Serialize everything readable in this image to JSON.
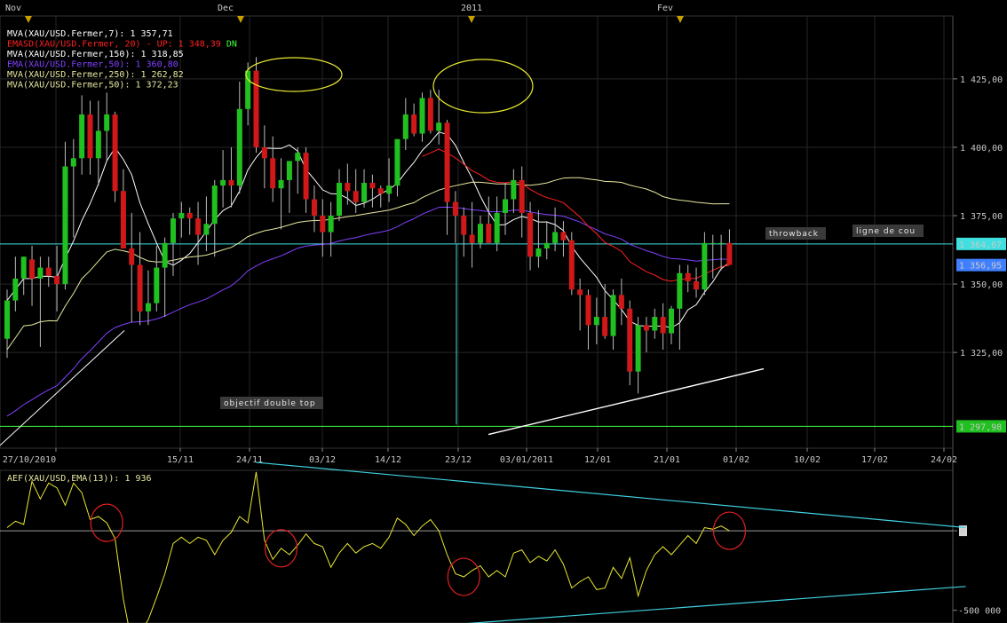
{
  "chart_data": [
    {
      "type": "candlestick",
      "months": [
        "Nov",
        "Dec",
        "2011",
        "Fev"
      ],
      "legend": [
        {
          "text": "MVA(XAU/USD.Fermer,7): 1 357,71",
          "color": "#ffffff",
          "extra": "",
          "extra_color": ""
        },
        {
          "text": "EMASD(XAU/USD.Fermer, 20) - UP: 1 348,39",
          "color": "#ff2020",
          "extra": "DN",
          "extra_color": "#40ff40"
        },
        {
          "text": "MVA(XAU/USD.Fermer,150): 1 318,85",
          "color": "#ffffff",
          "extra": "",
          "extra_color": ""
        },
        {
          "text": "EMA(XAU/USD.Fermer,50): 1 360,80",
          "color": "#8040ff",
          "extra": "",
          "extra_color": ""
        },
        {
          "text": "MVA(XAU/USD.Fermer,250): 1 262,82",
          "color": "#e8e8a0",
          "extra": "",
          "extra_color": ""
        },
        {
          "text": "MVA(XAU/USD.Fermer,50): 1 372,23",
          "color": "#e8e8a0",
          "extra": "",
          "extra_color": ""
        }
      ],
      "y_ticks": [
        "1 425,00",
        "1 400,00",
        "1 375,00",
        "1 350,00",
        "1 325,00"
      ],
      "y_tick_values": [
        1425,
        1400,
        1375,
        1350,
        1325
      ],
      "ylim": [
        1290,
        1448
      ],
      "x_ticks": [
        "27/10/2010",
        "15/11",
        "24/11",
        "03/12",
        "14/12",
        "23/12",
        "03/01/2011",
        "12/01",
        "21/01",
        "01/02",
        "10/02",
        "17/02",
        "24/02"
      ],
      "price_labels": [
        {
          "text": "1 364,67",
          "value": 1364.67,
          "bg": "#40e0e0"
        },
        {
          "text": "1 356,95",
          "value": 1356.95,
          "bg": "#4080ff"
        },
        {
          "text": "1 297,98",
          "value": 1297.98,
          "bg": "#20c020"
        }
      ],
      "horizontal_lines": [
        {
          "value": 1364.67,
          "color": "#40e0e0"
        },
        {
          "value": 1297.98,
          "color": "#40ff40"
        }
      ],
      "annotations": [
        "objectif double top",
        "throwback",
        "ligne de cou"
      ],
      "candles": [
        {
          "o": 1330,
          "h": 1348,
          "l": 1323,
          "c": 1344
        },
        {
          "o": 1344,
          "h": 1360,
          "l": 1340,
          "c": 1352
        },
        {
          "o": 1352,
          "h": 1360,
          "l": 1346,
          "c": 1360
        },
        {
          "o": 1359,
          "h": 1364,
          "l": 1342,
          "c": 1352
        },
        {
          "o": 1352,
          "h": 1360,
          "l": 1327,
          "c": 1356
        },
        {
          "o": 1356,
          "h": 1360,
          "l": 1349,
          "c": 1353
        },
        {
          "o": 1353,
          "h": 1364,
          "l": 1340,
          "c": 1350
        },
        {
          "o": 1350,
          "h": 1402,
          "l": 1348,
          "c": 1393
        },
        {
          "o": 1393,
          "h": 1403,
          "l": 1367,
          "c": 1396
        },
        {
          "o": 1396,
          "h": 1419,
          "l": 1390,
          "c": 1412
        },
        {
          "o": 1412,
          "h": 1417,
          "l": 1390,
          "c": 1396
        },
        {
          "o": 1396,
          "h": 1417,
          "l": 1386,
          "c": 1406
        },
        {
          "o": 1406,
          "h": 1420,
          "l": 1395,
          "c": 1412
        },
        {
          "o": 1412,
          "h": 1413,
          "l": 1380,
          "c": 1384
        },
        {
          "o": 1384,
          "h": 1392,
          "l": 1366,
          "c": 1363
        },
        {
          "o": 1363,
          "h": 1376,
          "l": 1336,
          "c": 1357
        },
        {
          "o": 1357,
          "h": 1369,
          "l": 1335,
          "c": 1340
        },
        {
          "o": 1340,
          "h": 1355,
          "l": 1335,
          "c": 1343
        },
        {
          "o": 1343,
          "h": 1364,
          "l": 1340,
          "c": 1356
        },
        {
          "o": 1356,
          "h": 1367,
          "l": 1338,
          "c": 1365
        },
        {
          "o": 1365,
          "h": 1376,
          "l": 1353,
          "c": 1374
        },
        {
          "o": 1374,
          "h": 1380,
          "l": 1367,
          "c": 1376
        },
        {
          "o": 1376,
          "h": 1378,
          "l": 1368,
          "c": 1374
        },
        {
          "o": 1374,
          "h": 1380,
          "l": 1357,
          "c": 1368
        },
        {
          "o": 1368,
          "h": 1382,
          "l": 1362,
          "c": 1372
        },
        {
          "o": 1372,
          "h": 1388,
          "l": 1360,
          "c": 1386
        },
        {
          "o": 1386,
          "h": 1399,
          "l": 1378,
          "c": 1388
        },
        {
          "o": 1388,
          "h": 1400,
          "l": 1378,
          "c": 1386
        },
        {
          "o": 1386,
          "h": 1424,
          "l": 1383,
          "c": 1414
        },
        {
          "o": 1414,
          "h": 1431,
          "l": 1408,
          "c": 1428
        },
        {
          "o": 1428,
          "h": 1433,
          "l": 1398,
          "c": 1400
        },
        {
          "o": 1400,
          "h": 1408,
          "l": 1385,
          "c": 1396
        },
        {
          "o": 1396,
          "h": 1404,
          "l": 1380,
          "c": 1385
        },
        {
          "o": 1385,
          "h": 1396,
          "l": 1370,
          "c": 1388
        },
        {
          "o": 1388,
          "h": 1393,
          "l": 1376,
          "c": 1395
        },
        {
          "o": 1395,
          "h": 1400,
          "l": 1383,
          "c": 1398
        },
        {
          "o": 1398,
          "h": 1400,
          "l": 1376,
          "c": 1381
        },
        {
          "o": 1381,
          "h": 1386,
          "l": 1369,
          "c": 1375
        },
        {
          "o": 1375,
          "h": 1381,
          "l": 1360,
          "c": 1369
        },
        {
          "o": 1369,
          "h": 1380,
          "l": 1360,
          "c": 1375
        },
        {
          "o": 1375,
          "h": 1392,
          "l": 1373,
          "c": 1387
        },
        {
          "o": 1387,
          "h": 1394,
          "l": 1379,
          "c": 1384
        },
        {
          "o": 1384,
          "h": 1392,
          "l": 1376,
          "c": 1380
        },
        {
          "o": 1380,
          "h": 1392,
          "l": 1378,
          "c": 1387
        },
        {
          "o": 1387,
          "h": 1390,
          "l": 1378,
          "c": 1385
        },
        {
          "o": 1385,
          "h": 1386,
          "l": 1378,
          "c": 1383
        },
        {
          "o": 1383,
          "h": 1396,
          "l": 1380,
          "c": 1386
        },
        {
          "o": 1386,
          "h": 1402,
          "l": 1382,
          "c": 1403
        },
        {
          "o": 1403,
          "h": 1418,
          "l": 1399,
          "c": 1412
        },
        {
          "o": 1412,
          "h": 1416,
          "l": 1404,
          "c": 1405
        },
        {
          "o": 1405,
          "h": 1420,
          "l": 1402,
          "c": 1418
        },
        {
          "o": 1418,
          "h": 1421,
          "l": 1405,
          "c": 1406
        },
        {
          "o": 1406,
          "h": 1421,
          "l": 1401,
          "c": 1409
        },
        {
          "o": 1409,
          "h": 1410,
          "l": 1368,
          "c": 1380
        },
        {
          "o": 1380,
          "h": 1384,
          "l": 1365,
          "c": 1375
        },
        {
          "o": 1375,
          "h": 1378,
          "l": 1360,
          "c": 1368
        },
        {
          "o": 1368,
          "h": 1380,
          "l": 1356,
          "c": 1365
        },
        {
          "o": 1365,
          "h": 1375,
          "l": 1363,
          "c": 1372
        },
        {
          "o": 1372,
          "h": 1382,
          "l": 1365,
          "c": 1365
        },
        {
          "o": 1365,
          "h": 1382,
          "l": 1362,
          "c": 1376
        },
        {
          "o": 1376,
          "h": 1387,
          "l": 1368,
          "c": 1381
        },
        {
          "o": 1381,
          "h": 1392,
          "l": 1376,
          "c": 1388
        },
        {
          "o": 1388,
          "h": 1393,
          "l": 1367,
          "c": 1376
        },
        {
          "o": 1376,
          "h": 1380,
          "l": 1355,
          "c": 1360
        },
        {
          "o": 1360,
          "h": 1377,
          "l": 1356,
          "c": 1363
        },
        {
          "o": 1363,
          "h": 1373,
          "l": 1359,
          "c": 1365
        },
        {
          "o": 1365,
          "h": 1378,
          "l": 1362,
          "c": 1369
        },
        {
          "o": 1369,
          "h": 1373,
          "l": 1360,
          "c": 1366
        },
        {
          "o": 1366,
          "h": 1369,
          "l": 1346,
          "c": 1348
        },
        {
          "o": 1348,
          "h": 1352,
          "l": 1333,
          "c": 1346
        },
        {
          "o": 1346,
          "h": 1348,
          "l": 1326,
          "c": 1335
        },
        {
          "o": 1335,
          "h": 1345,
          "l": 1328,
          "c": 1338
        },
        {
          "o": 1338,
          "h": 1350,
          "l": 1330,
          "c": 1331
        },
        {
          "o": 1331,
          "h": 1348,
          "l": 1326,
          "c": 1346
        },
        {
          "o": 1346,
          "h": 1352,
          "l": 1335,
          "c": 1341
        },
        {
          "o": 1341,
          "h": 1344,
          "l": 1313,
          "c": 1318
        },
        {
          "o": 1318,
          "h": 1338,
          "l": 1310,
          "c": 1335
        },
        {
          "o": 1335,
          "h": 1338,
          "l": 1325,
          "c": 1333
        },
        {
          "o": 1333,
          "h": 1341,
          "l": 1330,
          "c": 1338
        },
        {
          "o": 1338,
          "h": 1343,
          "l": 1326,
          "c": 1332
        },
        {
          "o": 1332,
          "h": 1342,
          "l": 1328,
          "c": 1341
        },
        {
          "o": 1341,
          "h": 1357,
          "l": 1326,
          "c": 1354
        },
        {
          "o": 1354,
          "h": 1357,
          "l": 1347,
          "c": 1351
        },
        {
          "o": 1351,
          "h": 1356,
          "l": 1345,
          "c": 1348
        },
        {
          "o": 1348,
          "h": 1369,
          "l": 1346,
          "c": 1365
        },
        {
          "o": 1365,
          "h": 1368,
          "l": 1352,
          "c": 1365
        },
        {
          "o": 1365,
          "h": 1368,
          "l": 1355,
          "c": 1365
        },
        {
          "o": 1365,
          "h": 1370,
          "l": 1358,
          "c": 1357
        }
      ]
    },
    {
      "type": "line",
      "title": "AEF(XAU/USD,EMA(13)): 1 936",
      "y_ticks": [
        "0",
        "-500 000"
      ],
      "y_tick_values": [
        0,
        -500000
      ],
      "ylim": [
        -580000,
        380000
      ],
      "values": [
        20000,
        60000,
        40000,
        310000,
        200000,
        300000,
        270000,
        160000,
        300000,
        240000,
        70000,
        90000,
        50000,
        -50000,
        -430000,
        -700000,
        -640000,
        -560000,
        -420000,
        -270000,
        -80000,
        -40000,
        -80000,
        -40000,
        -60000,
        -150000,
        -60000,
        -10000,
        90000,
        50000,
        370000,
        -60000,
        -180000,
        -110000,
        -150000,
        -90000,
        -20000,
        -80000,
        -100000,
        -230000,
        -140000,
        -80000,
        -140000,
        -100000,
        -80000,
        -110000,
        -40000,
        80000,
        40000,
        -30000,
        30000,
        70000,
        0,
        -150000,
        -270000,
        -290000,
        -250000,
        -220000,
        -290000,
        -250000,
        -290000,
        -140000,
        -120000,
        -200000,
        -160000,
        -190000,
        -120000,
        -210000,
        -360000,
        -320000,
        -290000,
        -370000,
        -360000,
        -230000,
        -300000,
        -170000,
        -410000,
        -250000,
        -150000,
        -100000,
        -150000,
        -90000,
        -30000,
        -80000,
        20000,
        10000,
        30000,
        0
      ],
      "trendlines": [
        {
          "from_index": 30,
          "from_value": 430000,
          "to_index": 130,
          "to_value": 20000,
          "color": "#40d0e0"
        },
        {
          "from_index": 15,
          "from_value": -740000,
          "to_index": 130,
          "to_value": -350000,
          "color": "#40d0e0"
        }
      ],
      "ellipses_at_indices": [
        12,
        33,
        55,
        87
      ]
    }
  ]
}
